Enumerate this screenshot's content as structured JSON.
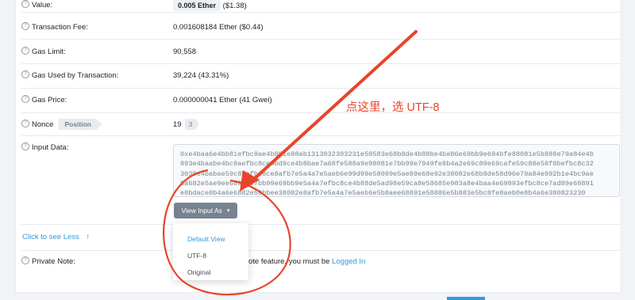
{
  "rows": {
    "value": {
      "label": "Value:",
      "amount": "0.005 Ether",
      "usd": "($1.38)"
    },
    "fee": {
      "label": "Transaction Fee:",
      "value": "0.001608184 Ether ($0.44)"
    },
    "gas_limit": {
      "label": "Gas Limit:",
      "value": "90,558"
    },
    "gas_used": {
      "label": "Gas Used by Transaction:",
      "value": "39,224 (43.31%)"
    },
    "gas_price": {
      "label": "Gas Price:",
      "value": "0.000000041 Ether (41 Gwei)"
    },
    "nonce": {
      "label": "Nonce",
      "position_tag": "Position",
      "value": "19",
      "position_value": "3"
    },
    "input": {
      "label": "Input Data:",
      "lines": [
        "0xe4baa6e4bb81efbc9ae4b891e88ab1313032303231e58583e68b8de4b88be4ba86e69bb9e694bfe88081e5b888e79a84e4b",
        "893e4baabe4bc9aefbc8ce4bd9ce4b8bae7a68fe588a9e98081e7bb99e7949fe8b4a2e69c89e69cafe59c88e58f8befbc8c32",
        "3030e4babae59c8befbc8ce8afb7e5a4a7e5aeb6e99d99e58099e5ae89e68e92e38082e68b8de58d96e79a84e992b1e4bc9ae",
        "5a682e5ae9ee68993e7bb99e69bb9e5a4a7efbc8ce4b88de5ad98e59ca8e58685e983a8e4baa4e69893efbc8ce7ad89e68891",
        "e8bdace8b4a6e6882e59bbee38082e8afb7e5a4a7e5aeb6e5b8aee68891e58886e5b883e5bc8fe8aeb0e8b4a6e380823230"
      ],
      "button": "View Input As",
      "dropdown": [
        "Default View",
        "UTF-8",
        "Original"
      ]
    },
    "see_less": "Click to see Less",
    "private_note": {
      "label": "Private Note:",
      "text_before": "ote feature, you must be",
      "link": "Logged In"
    }
  },
  "annotation": "点这里，选 UTF-8",
  "colors": {
    "accent": "#3498db",
    "annotation": "#e8452a"
  }
}
